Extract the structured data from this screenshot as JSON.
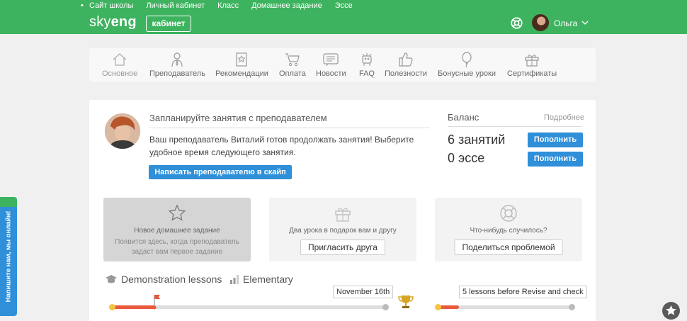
{
  "header": {
    "links": [
      "Сайт школы",
      "Личный кабинет",
      "Класс",
      "Домашнее задание",
      "Эссе"
    ],
    "logo_light": "sky",
    "logo_bold": "eng",
    "cabinet_button": "кабинет",
    "user_name": "Ольга"
  },
  "nav": {
    "items": [
      {
        "label": "Основное",
        "icon": "home-icon"
      },
      {
        "label": "Преподаватель",
        "icon": "teacher-icon"
      },
      {
        "label": "Рекомендации",
        "icon": "bookmark-icon"
      },
      {
        "label": "Оплата",
        "icon": "cart-icon"
      },
      {
        "label": "Новости",
        "icon": "news-icon"
      },
      {
        "label": "FAQ",
        "icon": "robot-icon"
      },
      {
        "label": "Полезности",
        "icon": "thumbs-up-icon"
      },
      {
        "label": "Бонусные уроки",
        "icon": "balloon-icon"
      },
      {
        "label": "Сертификаты",
        "icon": "gift-icon"
      }
    ]
  },
  "plan": {
    "title": "Запланируйте занятия с преподавателем",
    "text": "Ваш преподаватель Виталий готов продолжать занятия! Выберите удобное время следующего занятия.",
    "button": "Написать преподавателю в скайп"
  },
  "balance": {
    "title": "Баланс",
    "more": "Подробнее",
    "lessons": "6 занятий",
    "essays": "0 эссе",
    "topup": "Пополнить"
  },
  "tiles": {
    "homework": {
      "title": "Новое домашнее задание",
      "text": "Появится здесь, когда преподаватель задаст вам первое задание"
    },
    "invite": {
      "title": "Два урока в подарок вам и другу",
      "button": "Пригласить друга"
    },
    "problem": {
      "title": "Что-нибудь случилось?",
      "button": "Поделиться проблемой"
    }
  },
  "progress": {
    "course": "Demonstration lessons",
    "level": "Elementary",
    "date_tag": "November 16th",
    "revise_tag": "5 lessons before Revise and check",
    "course_progress": 0.16,
    "revise_progress": 0.16
  },
  "chat": {
    "label": "Напишите нам, мы онлайн!"
  },
  "colors": {
    "brand": "#3eb35f",
    "button": "#2f8fd8",
    "progress": "#e8593c",
    "start": "#f6c343"
  }
}
